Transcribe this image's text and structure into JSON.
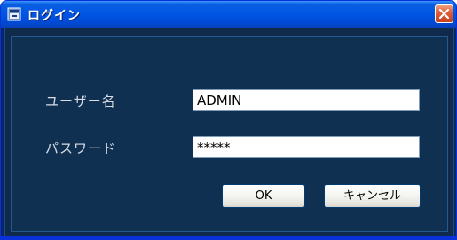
{
  "window": {
    "title": "ログイン"
  },
  "form": {
    "username_label": "ユーザー名",
    "username_value": "ADMIN",
    "password_label": "パスワード",
    "password_value": "*****"
  },
  "buttons": {
    "ok_label": "OK",
    "cancel_label": "キャンセル"
  },
  "icons": {
    "title_icon": "app-window-icon",
    "close_icon": "close-x-icon"
  },
  "colors": {
    "titlebar": "#0055e5",
    "close_button": "#e0603a",
    "client_background": "#0f3051",
    "label_text": "#d8dde6"
  }
}
